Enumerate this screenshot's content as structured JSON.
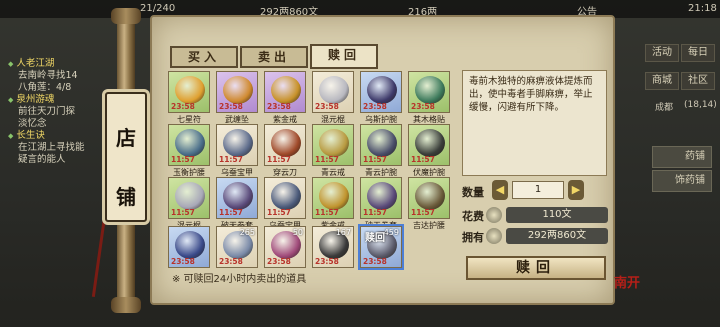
{
  "topbar": {
    "partial_count": "21/240",
    "currency1": "292两860文",
    "currency2": "216两",
    "notice": "公告",
    "time": "21:18"
  },
  "quests": [
    {
      "title": "人老江湖",
      "lines": [
        "去南岭寻找14",
        "八角莲：4/8"
      ]
    },
    {
      "title": "泉州游魂",
      "lines": [
        "前往天刀门探",
        "淡忆念"
      ]
    },
    {
      "title": "长生诀",
      "lines": [
        "在江湖上寻找能",
        "疑言的能人"
      ]
    }
  ],
  "right": {
    "btn1": "活动",
    "btn2": "每日",
    "btn3": "商城",
    "btn4": "社区",
    "location": "成都",
    "coords": "(18,14)",
    "side1": "药铺",
    "side2": "饰药铺"
  },
  "shop": {
    "banner_char1": "店",
    "banner_char2": "铺",
    "seal": "南开"
  },
  "tabs": [
    "买入",
    "卖出",
    "赎回"
  ],
  "grid": [
    {
      "name": "七星符",
      "time": "23:58",
      "color": "g",
      "iconColor": "#e0a030"
    },
    {
      "name": "武缠坠",
      "time": "23:58",
      "color": "p",
      "iconColor": "#d08a30"
    },
    {
      "name": "紫金戒",
      "time": "23:58",
      "color": "p",
      "iconColor": "#c8922a"
    },
    {
      "name": "混元棍",
      "time": "23:58",
      "color": "w",
      "iconColor": "#b8b8c0"
    },
    {
      "name": "乌斯护腕",
      "time": "23:58",
      "color": "b",
      "iconColor": "#3e3a6a"
    },
    {
      "name": "其木格贴",
      "time": "23:58",
      "color": "g",
      "iconColor": "#3d7a5c"
    },
    {
      "name": "玉衡护腰",
      "time": "11:57",
      "color": "g",
      "iconColor": "#4a6e8a"
    },
    {
      "name": "乌蚕宝甲",
      "time": "11:57",
      "color": "w",
      "iconColor": "#5b6a8a"
    },
    {
      "name": "穿云刀",
      "time": "11:57",
      "color": "w",
      "iconColor": "#a04a2a"
    },
    {
      "name": "青云戒",
      "time": "11:57",
      "color": "g",
      "iconColor": "#b89a40"
    },
    {
      "name": "青云护腕",
      "time": "11:57",
      "color": "g",
      "iconColor": "#4a4e6a"
    },
    {
      "name": "伏魔护腕",
      "time": "11:57",
      "color": "g",
      "iconColor": "#3a3e3a"
    },
    {
      "name": "混元棍",
      "time": "11:57",
      "color": "g",
      "iconColor": "#a8a8b8"
    },
    {
      "name": "破天拳套",
      "time": "11:57",
      "color": "b",
      "iconColor": "#5a4a7a"
    },
    {
      "name": "乌蚕宝甲",
      "time": "11:57",
      "color": "w",
      "iconColor": "#4b5a7a"
    },
    {
      "name": "紫金戒",
      "time": "11:57",
      "color": "g",
      "iconColor": "#c0942e"
    },
    {
      "name": "破天拳套",
      "time": "11:57",
      "color": "g",
      "iconColor": "#5a4a7a"
    },
    {
      "name": "吉达护腰",
      "time": "11:57",
      "color": "g",
      "iconColor": "#6a5a3a"
    },
    {
      "name": "",
      "time": "23:58",
      "color": "b",
      "iconColor": "#3a4a8a",
      "qty": ""
    },
    {
      "name": "",
      "time": "23:58",
      "color": "w",
      "iconColor": "#7a8aa8",
      "qty": "265"
    },
    {
      "name": "",
      "time": "23:58",
      "color": "w",
      "iconColor": "#a04a7a",
      "qty": "50"
    },
    {
      "name": "",
      "time": "23:58",
      "color": "w",
      "iconColor": "#3a3a3a",
      "qty": "167"
    },
    {
      "name": "",
      "time": "23:58",
      "color": "b",
      "iconColor": "#5a5a6a",
      "qty": "459",
      "redeem": "赎回"
    }
  ],
  "hint": "※ 可赎回24小时内卖出的道具",
  "detail": {
    "description": "毒前木独特的麻痹液体提炼而出，使中毒者手脚麻痹，举止缓慢，闪避有所下降。",
    "qty_label": "数量",
    "qty": "1",
    "cost_label": "花费",
    "cost": "110文",
    "own_label": "拥有",
    "own": "292两860文",
    "redeem_button": "赎回"
  }
}
